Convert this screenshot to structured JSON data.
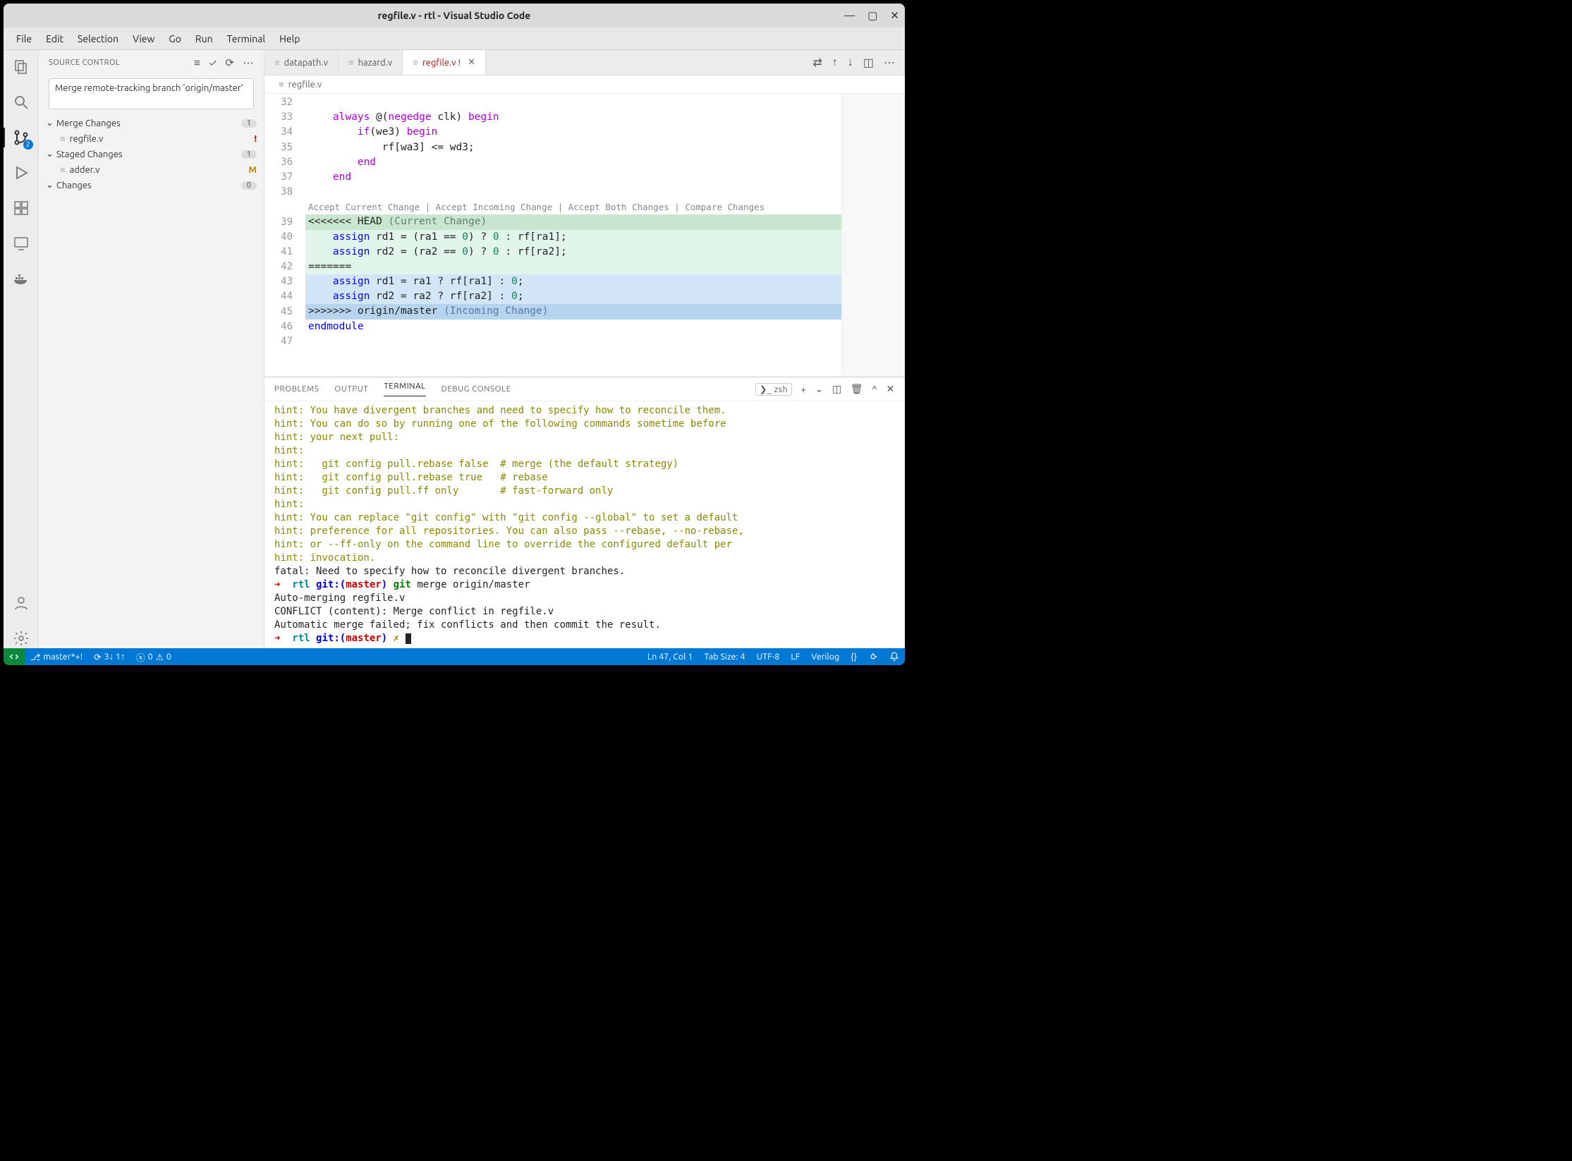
{
  "window": {
    "title": "regfile.v - rtl - Visual Studio Code"
  },
  "menubar": [
    "File",
    "Edit",
    "Selection",
    "View",
    "Go",
    "Run",
    "Terminal",
    "Help"
  ],
  "activitybar": {
    "scm_badge": "2"
  },
  "sidebar": {
    "title": "SOURCE CONTROL",
    "commit_message": "Merge remote-tracking branch 'origin/master'",
    "sections": [
      {
        "name": "Merge Changes",
        "count": "1",
        "files": [
          {
            "name": "regfile.v",
            "status": "!",
            "status_color": "#c00"
          }
        ]
      },
      {
        "name": "Staged Changes",
        "count": "1",
        "files": [
          {
            "name": "adder.v",
            "status": "M",
            "status_color": "#b58900"
          }
        ]
      },
      {
        "name": "Changes",
        "count": "0",
        "files": []
      }
    ]
  },
  "tabs": [
    {
      "label": "datapath.v",
      "active": false
    },
    {
      "label": "hazard.v",
      "active": false
    },
    {
      "label": "regfile.v !",
      "active": true,
      "modified": true
    }
  ],
  "breadcrumb": "regfile.v",
  "codelens": "Accept Current Change | Accept Incoming Change | Accept Both Changes | Compare Changes",
  "code_lines": [
    {
      "num": "32",
      "html": ""
    },
    {
      "num": "33",
      "html": "    <span class='hl-ctrl'>always</span> @(<span class='hl-ctrl'>negedge</span> clk) <span class='hl-ctrl'>begin</span>"
    },
    {
      "num": "34",
      "html": "        <span class='hl-ctrl'>if</span>(we3) <span class='hl-ctrl'>begin</span>"
    },
    {
      "num": "35",
      "html": "            rf[wa3] <= wd3;"
    },
    {
      "num": "36",
      "html": "        <span class='hl-ctrl'>end</span>"
    },
    {
      "num": "37",
      "html": "    <span class='hl-ctrl'>end</span>"
    },
    {
      "num": "38",
      "html": ""
    },
    {
      "codelens": true
    },
    {
      "num": "39",
      "cls": "conflict-head",
      "html": "<<<<<<< HEAD <span style='color:#6a7a6f'>(Current Change)</span>"
    },
    {
      "num": "40",
      "cls": "conflict-cur",
      "html": "    <span class='hl-kw'>assign</span> rd1 = (ra1 == <span class='hl-num'>0</span>) ? <span class='hl-num'>0</span> : rf[ra1];"
    },
    {
      "num": "41",
      "cls": "conflict-cur",
      "html": "    <span class='hl-kw'>assign</span> rd2 = (ra2 == <span class='hl-num'>0</span>) ? <span class='hl-num'>0</span> : rf[ra2];"
    },
    {
      "num": "42",
      "cls": "conflict-sep",
      "html": "======="
    },
    {
      "num": "43",
      "cls": "conflict-inc",
      "html": "    <span class='hl-kw'>assign</span> rd1 = ra1 ? rf[ra1] : <span class='hl-num'>0</span>;"
    },
    {
      "num": "44",
      "cls": "conflict-inc",
      "html": "    <span class='hl-kw'>assign</span> rd2 = ra2 ? rf[ra2] : <span class='hl-num'>0</span>;"
    },
    {
      "num": "45",
      "cls": "conflict-foot",
      "html": ">>>>>>> origin/master <span style='color:#5577aa'>(Incoming Change)</span>"
    },
    {
      "num": "46",
      "html": "<span class='hl-kw'>endmodule</span>"
    },
    {
      "num": "47",
      "html": ""
    }
  ],
  "panel": {
    "tabs": [
      "PROBLEMS",
      "OUTPUT",
      "TERMINAL",
      "DEBUG CONSOLE"
    ],
    "active_tab": "TERMINAL",
    "shell_label": "zsh"
  },
  "terminal_lines": [
    {
      "cls": "t-hint",
      "text": "hint: You have divergent branches and need to specify how to reconcile them."
    },
    {
      "cls": "t-hint",
      "text": "hint: You can do so by running one of the following commands sometime before"
    },
    {
      "cls": "t-hint",
      "text": "hint: your next pull:"
    },
    {
      "cls": "t-hint",
      "text": "hint:"
    },
    {
      "cls": "t-hint",
      "text": "hint:   git config pull.rebase false  # merge (the default strategy)"
    },
    {
      "cls": "t-hint",
      "text": "hint:   git config pull.rebase true   # rebase"
    },
    {
      "cls": "t-hint",
      "text": "hint:   git config pull.ff only       # fast-forward only"
    },
    {
      "cls": "t-hint",
      "text": "hint:"
    },
    {
      "cls": "t-hint",
      "text": "hint: You can replace \"git config\" with \"git config --global\" to set a default"
    },
    {
      "cls": "t-hint",
      "text": "hint: preference for all repositories. You can also pass --rebase, --no-rebase,"
    },
    {
      "cls": "t-hint",
      "text": "hint: or --ff-only on the command line to override the configured default per"
    },
    {
      "cls": "t-hint",
      "text": "hint: invocation."
    },
    {
      "cls": "t-fatal",
      "text": "fatal: Need to specify how to reconcile divergent branches."
    },
    {
      "prompt": true,
      "cmd": "git",
      "args": "merge origin/master"
    },
    {
      "cls": "t-fatal",
      "text": "Auto-merging regfile.v"
    },
    {
      "cls": "t-fatal",
      "text": "CONFLICT (content): Merge conflict in regfile.v"
    },
    {
      "cls": "t-fatal",
      "text": "Automatic merge failed; fix conflicts and then commit the result."
    },
    {
      "prompt": true,
      "dirty": true
    }
  ],
  "statusbar": {
    "branch": "master*+!",
    "sync": "3↓ 1↑",
    "errors": "0",
    "warnings": "0",
    "position": "Ln 47, Col 1",
    "tab_size": "Tab Size: 4",
    "encoding": "UTF-8",
    "eol": "LF",
    "lang": "Verilog"
  }
}
